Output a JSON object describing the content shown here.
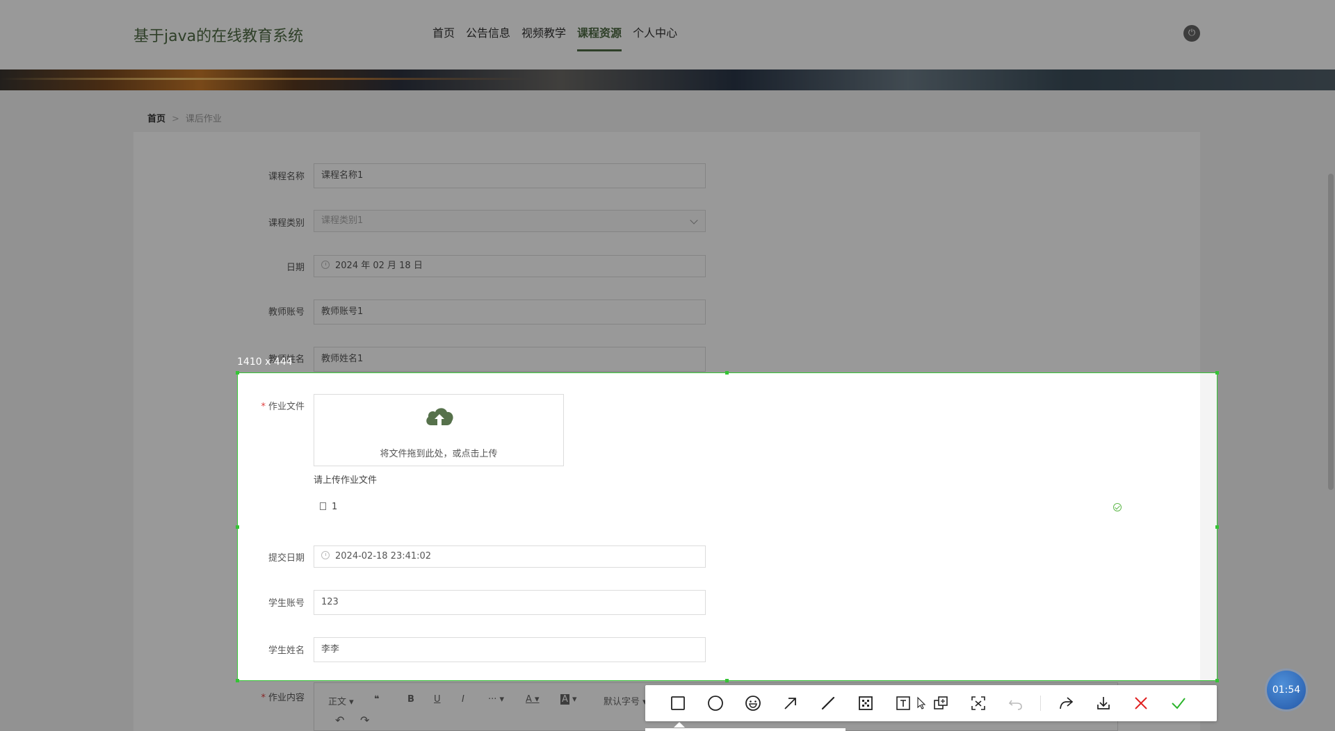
{
  "header": {
    "site_title": "基于java的在线教育系统",
    "nav": [
      "首页",
      "公告信息",
      "视频教学",
      "课程资源",
      "个人中心"
    ],
    "active_nav": "课程资源"
  },
  "breadcrumb": {
    "home": "首页",
    "separator": ">",
    "current": "课后作业"
  },
  "form": {
    "course_name": {
      "label": "课程名称",
      "value": "课程名称1"
    },
    "course_type": {
      "label": "课程类别",
      "value": "课程类别1"
    },
    "date": {
      "label": "日期",
      "value": "2024 年 02 月 18 日"
    },
    "teacher_account": {
      "label": "教师账号",
      "value": "教师账号1"
    },
    "teacher_name": {
      "label": "教师姓名",
      "value": "教师姓名1"
    },
    "homework_file": {
      "label": "作业文件",
      "drop_text": "将文件拖到此处，或点击上传",
      "tip": "请上传作业文件",
      "file_name": "1"
    },
    "submit_date": {
      "label": "提交日期",
      "value": "2024-02-18 23:41:02"
    },
    "student_account": {
      "label": "学生账号",
      "value": "123"
    },
    "student_name": {
      "label": "学生姓名",
      "value": "李李"
    },
    "homework_content": {
      "label": "作业内容",
      "toolbar": {
        "paragraph": "正文",
        "bold": "B",
        "underline": "U",
        "italic": "I",
        "more": "···",
        "font_color": "A",
        "bg_color": "A",
        "font_size": "默认字号"
      }
    }
  },
  "capture": {
    "size_label": "1410 x 444",
    "tools": [
      "rectangle-icon",
      "ellipse-icon",
      "emoji-icon",
      "arrow-icon",
      "pen-icon",
      "mosaic-icon",
      "text-icon",
      "pin-icon",
      "ocr-icon",
      "undo-icon",
      "share-icon",
      "download-icon",
      "close-icon",
      "confirm-icon"
    ],
    "accent": "#35c435",
    "cancel_color": "#e02020",
    "confirm_color": "#2bb42b"
  },
  "timer": "01:54"
}
